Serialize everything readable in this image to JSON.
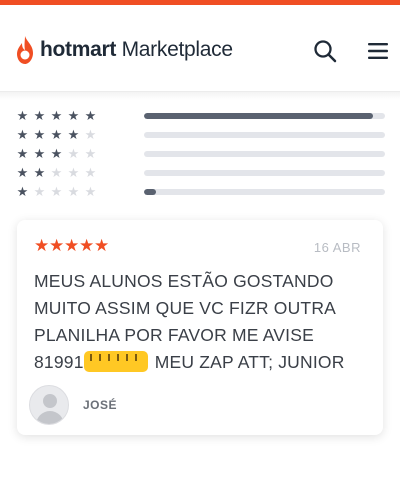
{
  "header": {
    "brand_bold": "hotmart",
    "brand_light": " Marketplace",
    "icons": {
      "logo": "flame-logo-icon",
      "search": "search-icon",
      "menu": "hamburger-menu-icon"
    }
  },
  "rating_breakdown": [
    {
      "stars": 5,
      "fill": 0.95
    },
    {
      "stars": 4,
      "fill": 0
    },
    {
      "stars": 3,
      "fill": 0
    },
    {
      "stars": 2,
      "fill": 0
    },
    {
      "stars": 1,
      "fill": 0.05
    }
  ],
  "review": {
    "stars": 5,
    "date": "16 ABR",
    "text_lines": [
      "MEUS ALUNOS ESTÃO GOSTANDO",
      "MUITO ASSIM QUE VC FIZR OUTRA",
      "PLANILHA POR FAVOR ME AVISE",
      "81991",
      " MEU ZAP ATT; JUNIOR"
    ],
    "author": "JOSÉ"
  },
  "colors": {
    "accent": "#f04e23",
    "bar_fill": "#5a6270",
    "bar_track": "#e3e5ea",
    "redaction": "#ffc824"
  }
}
